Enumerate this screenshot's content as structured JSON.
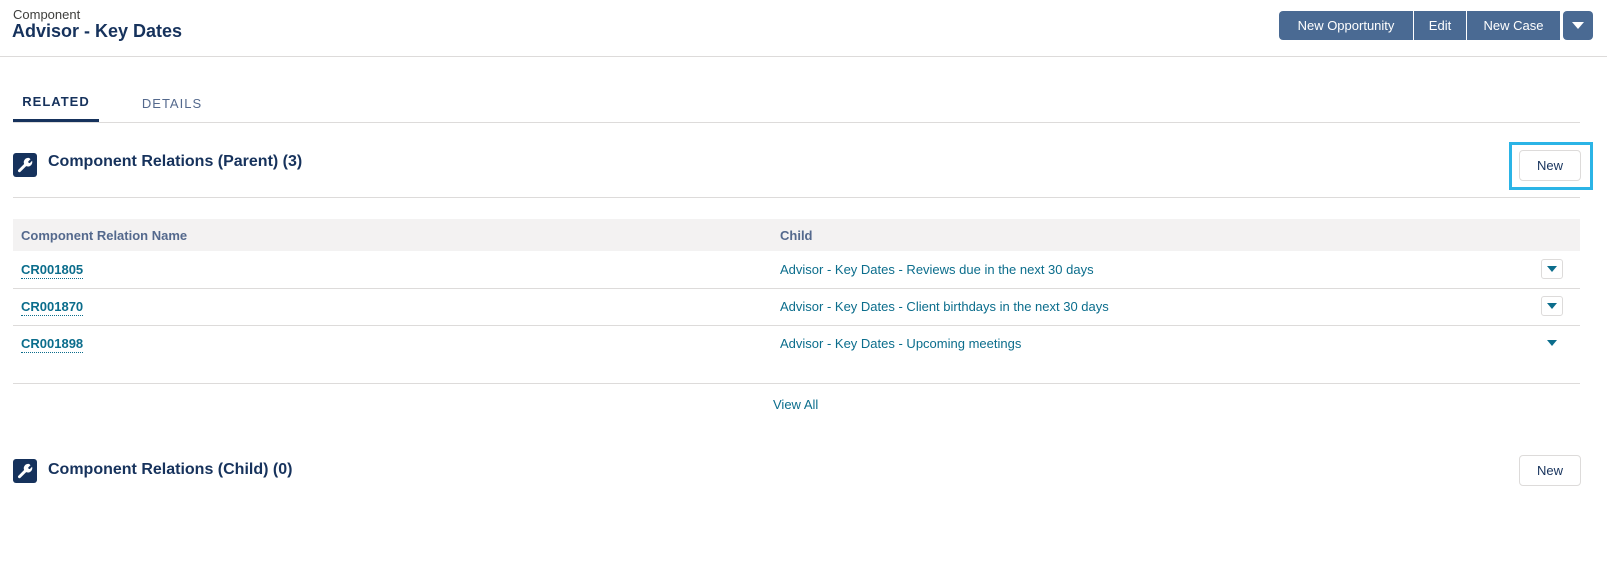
{
  "header": {
    "object_label": "Component",
    "record_title": "Advisor - Key Dates",
    "actions": [
      "New Opportunity",
      "Edit",
      "New Case"
    ],
    "more_icon": "chevron-down-icon"
  },
  "tabs": [
    {
      "label": "RELATED",
      "active": true
    },
    {
      "label": "DETAILS",
      "active": false
    }
  ],
  "parent_section": {
    "title": "Component Relations (Parent) (3)",
    "icon": "wrench-icon",
    "new_label": "New",
    "columns": [
      "Component Relation Name",
      "Child"
    ],
    "rows": [
      {
        "name": "CR001805",
        "child": "Advisor - Key Dates - Reviews due in the next 30 days"
      },
      {
        "name": "CR001870",
        "child": "Advisor - Key Dates - Client birthdays in the next 30 days"
      },
      {
        "name": "CR001898",
        "child": "Advisor - Key Dates - Upcoming meetings"
      }
    ],
    "view_all": "View All"
  },
  "child_section": {
    "title": "Component Relations (Child) (0)",
    "icon": "wrench-icon",
    "new_label": "New"
  },
  "colors": {
    "brand": "#4a6a93",
    "title": "#16325c",
    "link": "#0b6d8c",
    "highlight": "#2bb4e6"
  }
}
